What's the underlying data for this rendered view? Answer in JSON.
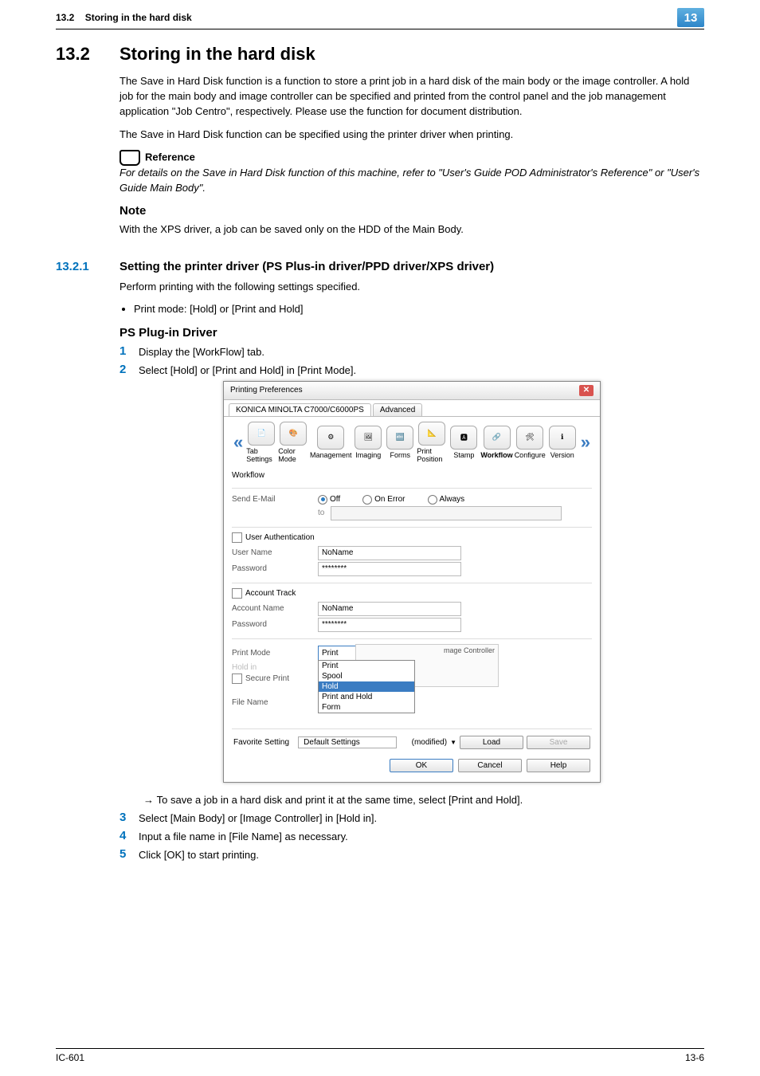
{
  "header": {
    "section_label": "13.2",
    "section_title_head": "Storing in the hard disk",
    "chapter_number": "13"
  },
  "section": {
    "number": "13.2",
    "title": "Storing in the hard disk",
    "para1": "The Save in Hard Disk function is a function to store a print job in a hard disk of the main body or the image controller. A hold job for the main body and image controller can be specified and printed from the control panel and the job management application \"Job Centro\", respectively. Please use the function for document distribution.",
    "para2": "The Save in Hard Disk function can be specified using the printer driver when printing.",
    "reference_label": "Reference",
    "reference_text": "For details on the Save in Hard Disk function of this machine, refer to \"User's Guide POD Administrator's Reference\" or \"User's Guide Main Body\".",
    "note_heading": "Note",
    "note_text": "With the XPS driver, a job can be saved only on the HDD of the Main Body."
  },
  "subsection": {
    "number": "13.2.1",
    "title": "Setting the printer driver (PS Plus-in driver/PPD driver/XPS driver)",
    "intro": "Perform printing with the following settings specified.",
    "bullet": "Print mode: [Hold] or [Print and Hold]",
    "driver_heading": "PS Plug-in Driver",
    "step1": "Display the [WorkFlow] tab.",
    "step2": "Select [Hold] or [Print and Hold] in [Print Mode].",
    "arrow_note": "To save a job in a hard disk and print it at the same time, select [Print and Hold].",
    "step3": " Select [Main Body] or [Image Controller] in [Hold in].",
    "step4": "Input a file name in [File Name] as necessary.",
    "step5": "Click [OK] to start printing."
  },
  "screenshot": {
    "window_title": "Printing Preferences",
    "tab1": "KONICA MINOLTA C7000/C6000PS",
    "tab2": "Advanced",
    "nav": {
      "tab_settings": "Tab Settings",
      "color_mode": "Color Mode",
      "management": "Management",
      "imaging": "Imaging",
      "forms": "Forms",
      "print_position": "Print Position",
      "stamp": "Stamp",
      "workflow": "Workflow",
      "configure": "Configure",
      "version": "Version"
    },
    "workflow_label": "Workflow",
    "send_email": {
      "label": "Send E-Mail",
      "off": "Off",
      "on_error": "On Error",
      "always": "Always",
      "to": "to"
    },
    "user_auth": {
      "title": "User Authentication",
      "user_name": "User Name",
      "user_name_val": "NoName",
      "password": "Password",
      "password_val": "********"
    },
    "account_track": {
      "title": "Account Track",
      "account_name": "Account Name",
      "account_name_val": "NoName",
      "password": "Password",
      "password_val": "********"
    },
    "print_mode": {
      "label": "Print Mode",
      "selected": "Print",
      "opt_print": "Print",
      "opt_spool": "Spool",
      "opt_hold": "Hold",
      "opt_print_hold": "Print and Hold",
      "opt_form": "Form"
    },
    "hold_in": {
      "label": "Hold in",
      "side_text": "mage Controller"
    },
    "secure_print": "Secure Print",
    "file_name": "File Name",
    "favorite": {
      "label": "Favorite Setting",
      "value": "Default Settings",
      "modified": "(modified)",
      "load": "Load",
      "save": "Save"
    },
    "buttons": {
      "ok": "OK",
      "cancel": "Cancel",
      "help": "Help"
    }
  },
  "footer": {
    "left": "IC-601",
    "right": "13-6"
  }
}
